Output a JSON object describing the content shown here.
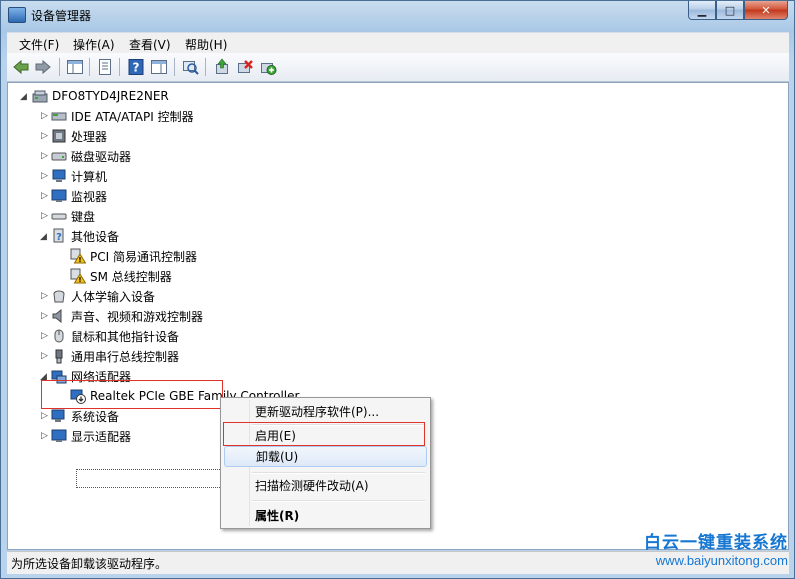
{
  "window": {
    "title": "设备管理器",
    "controls": {
      "minimize": "▁",
      "maximize": "□",
      "close": "✕"
    }
  },
  "menu": [
    "文件(F)",
    "操作(A)",
    "查看(V)",
    "帮助(H)"
  ],
  "tree": {
    "root": "DFO8TYD4JRE2NER",
    "items": [
      {
        "label": "IDE ATA/ATAPI 控制器"
      },
      {
        "label": "处理器"
      },
      {
        "label": "磁盘驱动器"
      },
      {
        "label": "计算机"
      },
      {
        "label": "监视器"
      },
      {
        "label": "键盘"
      },
      {
        "label": "其他设备"
      },
      {
        "label": "PCI 简易通讯控制器"
      },
      {
        "label": "SM 总线控制器"
      },
      {
        "label": "人体学输入设备"
      },
      {
        "label": "声音、视频和游戏控制器"
      },
      {
        "label": "鼠标和其他指针设备"
      },
      {
        "label": "通用串行总线控制器"
      },
      {
        "label": "网络适配器"
      },
      {
        "label": "Realtek PCIe GBE Family Controller"
      },
      {
        "label": "系统设备"
      },
      {
        "label": "显示适配器"
      }
    ]
  },
  "context_menu": {
    "update_driver": "更新驱动程序软件(P)...",
    "enable": "启用(E)",
    "uninstall": "卸载(U)",
    "scan": "扫描检测硬件改动(A)",
    "properties": "属性(R)"
  },
  "status": {
    "text": "为所选设备卸载该驱动程序。"
  },
  "watermark": {
    "main": "白云一键重装系统",
    "url": "www.baiyunxitong.com"
  },
  "colors": {
    "highlight_red": "#e0312a",
    "watermark_blue": "#1677d2",
    "warning_yellow": "#f3c21b"
  }
}
